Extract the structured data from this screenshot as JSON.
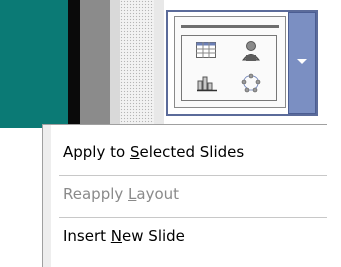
{
  "layout_gallery": {
    "thumbnail_icons": [
      "table-icon",
      "picture-icon",
      "chart-icon",
      "smartart-icon"
    ]
  },
  "context_menu": {
    "items": [
      {
        "pre": "Apply to ",
        "mn": "S",
        "post": "elected Slides",
        "enabled": true
      },
      {
        "pre": "Reapply ",
        "mn": "L",
        "post": "ayout",
        "enabled": false
      },
      {
        "pre": "Insert ",
        "mn": "N",
        "post": "ew Slide",
        "enabled": true
      }
    ]
  },
  "colors": {
    "teal_strip": "#0b7a75",
    "selection_border": "#5b6b9a",
    "dropdown": "#7b8fc2",
    "disabled_text": "#8a8a8a"
  }
}
